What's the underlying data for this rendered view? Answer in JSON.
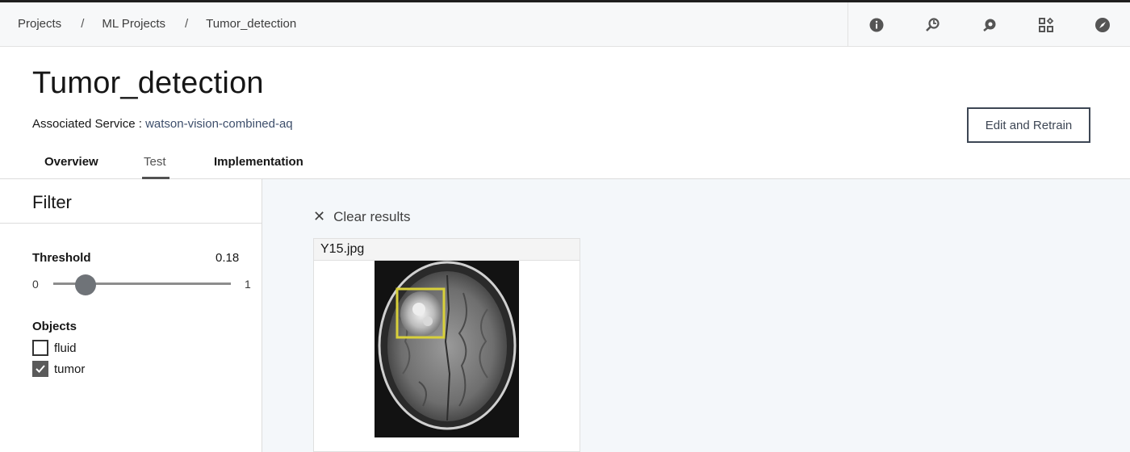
{
  "breadcrumb": {
    "items": [
      "Projects",
      "ML Projects",
      "Tumor_detection"
    ],
    "separator": "/"
  },
  "toolbar": {
    "icons": [
      "info-icon",
      "wrench-search-icon",
      "settings-circle-icon",
      "grid-apps-icon",
      "compass-icon"
    ]
  },
  "header": {
    "title": "Tumor_detection",
    "service_label": "Associated Service : ",
    "service_value": "watson-vision-combined-aq",
    "edit_button": "Edit and Retrain"
  },
  "tabs": {
    "overview": "Overview",
    "test": "Test",
    "implementation": "Implementation",
    "active": "Test"
  },
  "filter": {
    "title": "Filter",
    "threshold_label": "Threshold",
    "threshold_value": "0.18",
    "slider_min": "0",
    "slider_max": "1",
    "threshold_fraction": 0.18,
    "objects_label": "Objects",
    "objects": [
      {
        "label": "fluid",
        "checked": false
      },
      {
        "label": "tumor",
        "checked": true
      }
    ]
  },
  "results": {
    "clear_label": "Clear results",
    "card": {
      "filename": "Y15.jpg",
      "detection_label": "tumor",
      "box_color": "#d8d03a"
    }
  },
  "colors": {
    "accent": "#3d4654",
    "detection_box": "#d8d03a"
  }
}
